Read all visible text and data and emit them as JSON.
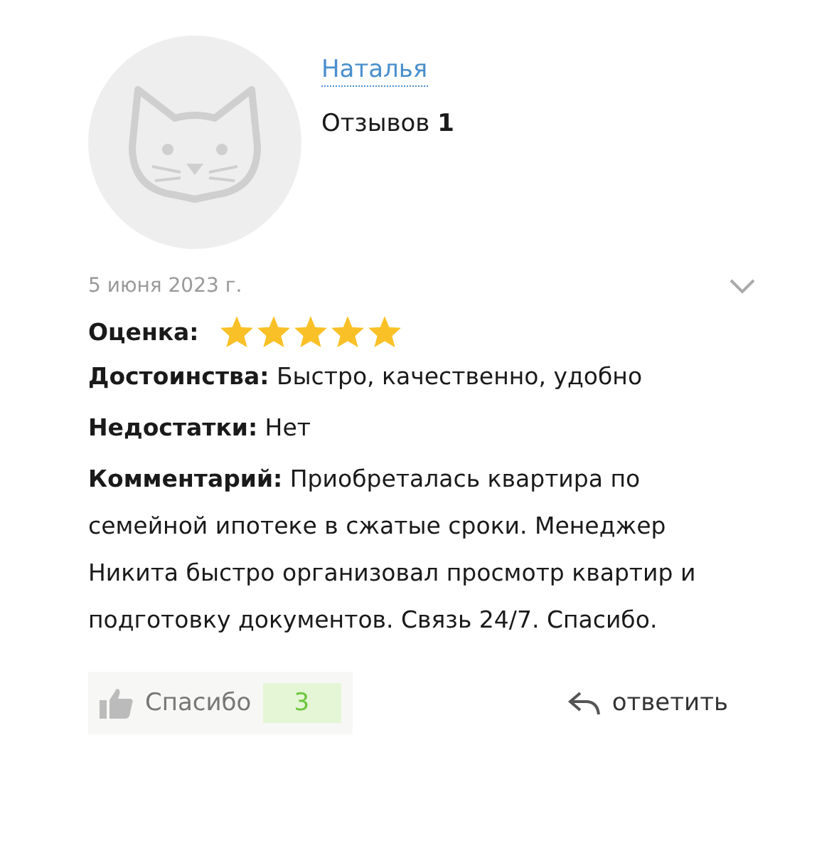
{
  "author": {
    "name": "Наталья",
    "reviews": "Отзывов **1**"
  },
  "date": "5 июня 2023 г.",
  "rating": {
    "label": "Оценка:",
    "stars": 5
  },
  "fields": [
    {
      "text": "**Достоинства:** Быстро, качественно, удобно"
    },
    {
      "text": "**Недостатки:** Нет"
    },
    {
      "text": "**Комментарий:** Приобреталась квартира по семейной ипотеке в сжатые сроки. Менеджер Никита быстро организовал просмотр квартир и подготовку документов. Связь 24/7. Спасибо."
    }
  ],
  "thanks": {
    "label": "Спасибо",
    "count": "3"
  },
  "reply": {
    "label": "ответить"
  }
}
